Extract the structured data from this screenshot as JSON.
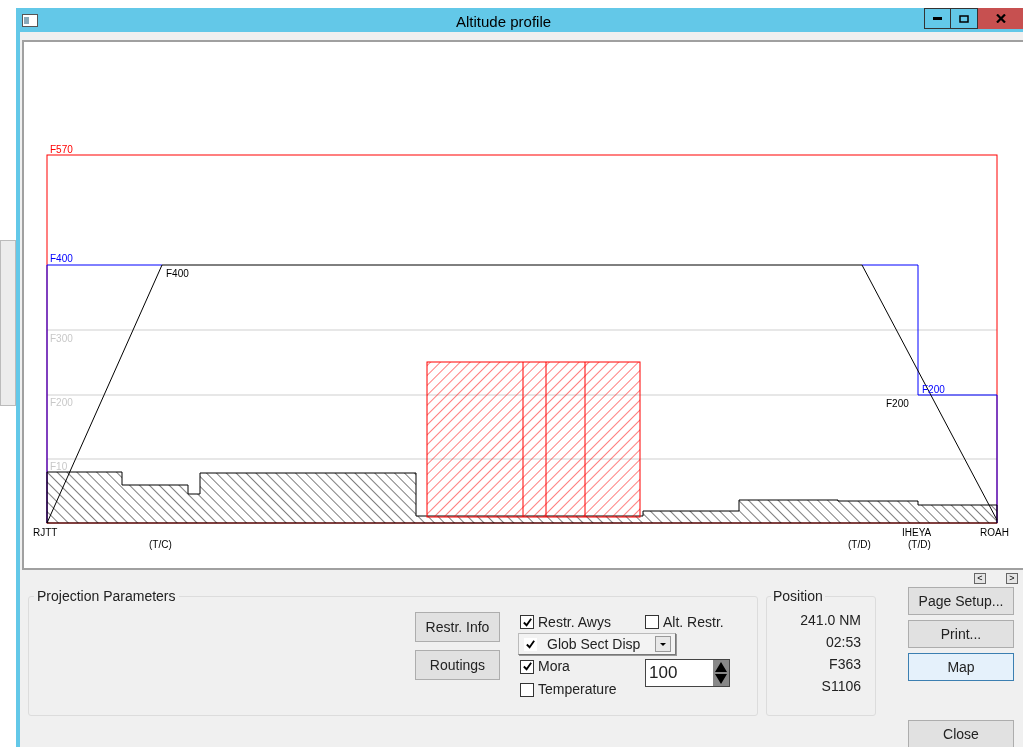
{
  "window": {
    "title": "Altitude profile"
  },
  "profile": {
    "labels": [
      {
        "text": "F570",
        "color": "#ff0000"
      },
      {
        "text": "F400",
        "color": "#0000ff"
      },
      {
        "text": "F400"
      },
      {
        "text": "F300",
        "color": "#c8c8c8"
      },
      {
        "text": "F200",
        "color": "#c8c8c8"
      },
      {
        "text": "F10",
        "color": "#c8c8c8"
      },
      {
        "text": "F200",
        "color": "#0000ff"
      },
      {
        "text": "F200"
      },
      {
        "text": "RJTT"
      },
      {
        "text": "(T/C)"
      },
      {
        "text": "(T/D)"
      },
      {
        "text": "IHEYA"
      },
      {
        "text": "(T/D)"
      },
      {
        "text": "ROAH"
      }
    ]
  },
  "page_nav": [
    "<",
    ">"
  ],
  "projection_parameters": {
    "title": "Projection Parameters",
    "buttons": [
      "Restr. Info",
      "Routings"
    ],
    "restr_awys": {
      "label": "Restr. Awys",
      "checked": true
    },
    "alt_restr": {
      "label": "Alt. Restr.",
      "checked": false
    },
    "sector_display": {
      "label": "Glob Sect Disp",
      "checked": true
    },
    "mora": {
      "label": "Mora",
      "checked": true
    },
    "temperature": {
      "label": "Temperature",
      "checked": false
    },
    "mora_value": {
      "value": "100"
    }
  },
  "position": {
    "title": "Position",
    "values": [
      "241.0 NM",
      "02:53",
      "F363",
      "S1106"
    ]
  },
  "buttons": [
    {
      "label": "Page Setup...",
      "focused": false
    },
    {
      "label": "Print...",
      "focused": false
    },
    {
      "label": "Map",
      "focused": true
    },
    {
      "label": "Close",
      "focused": false
    }
  ]
}
